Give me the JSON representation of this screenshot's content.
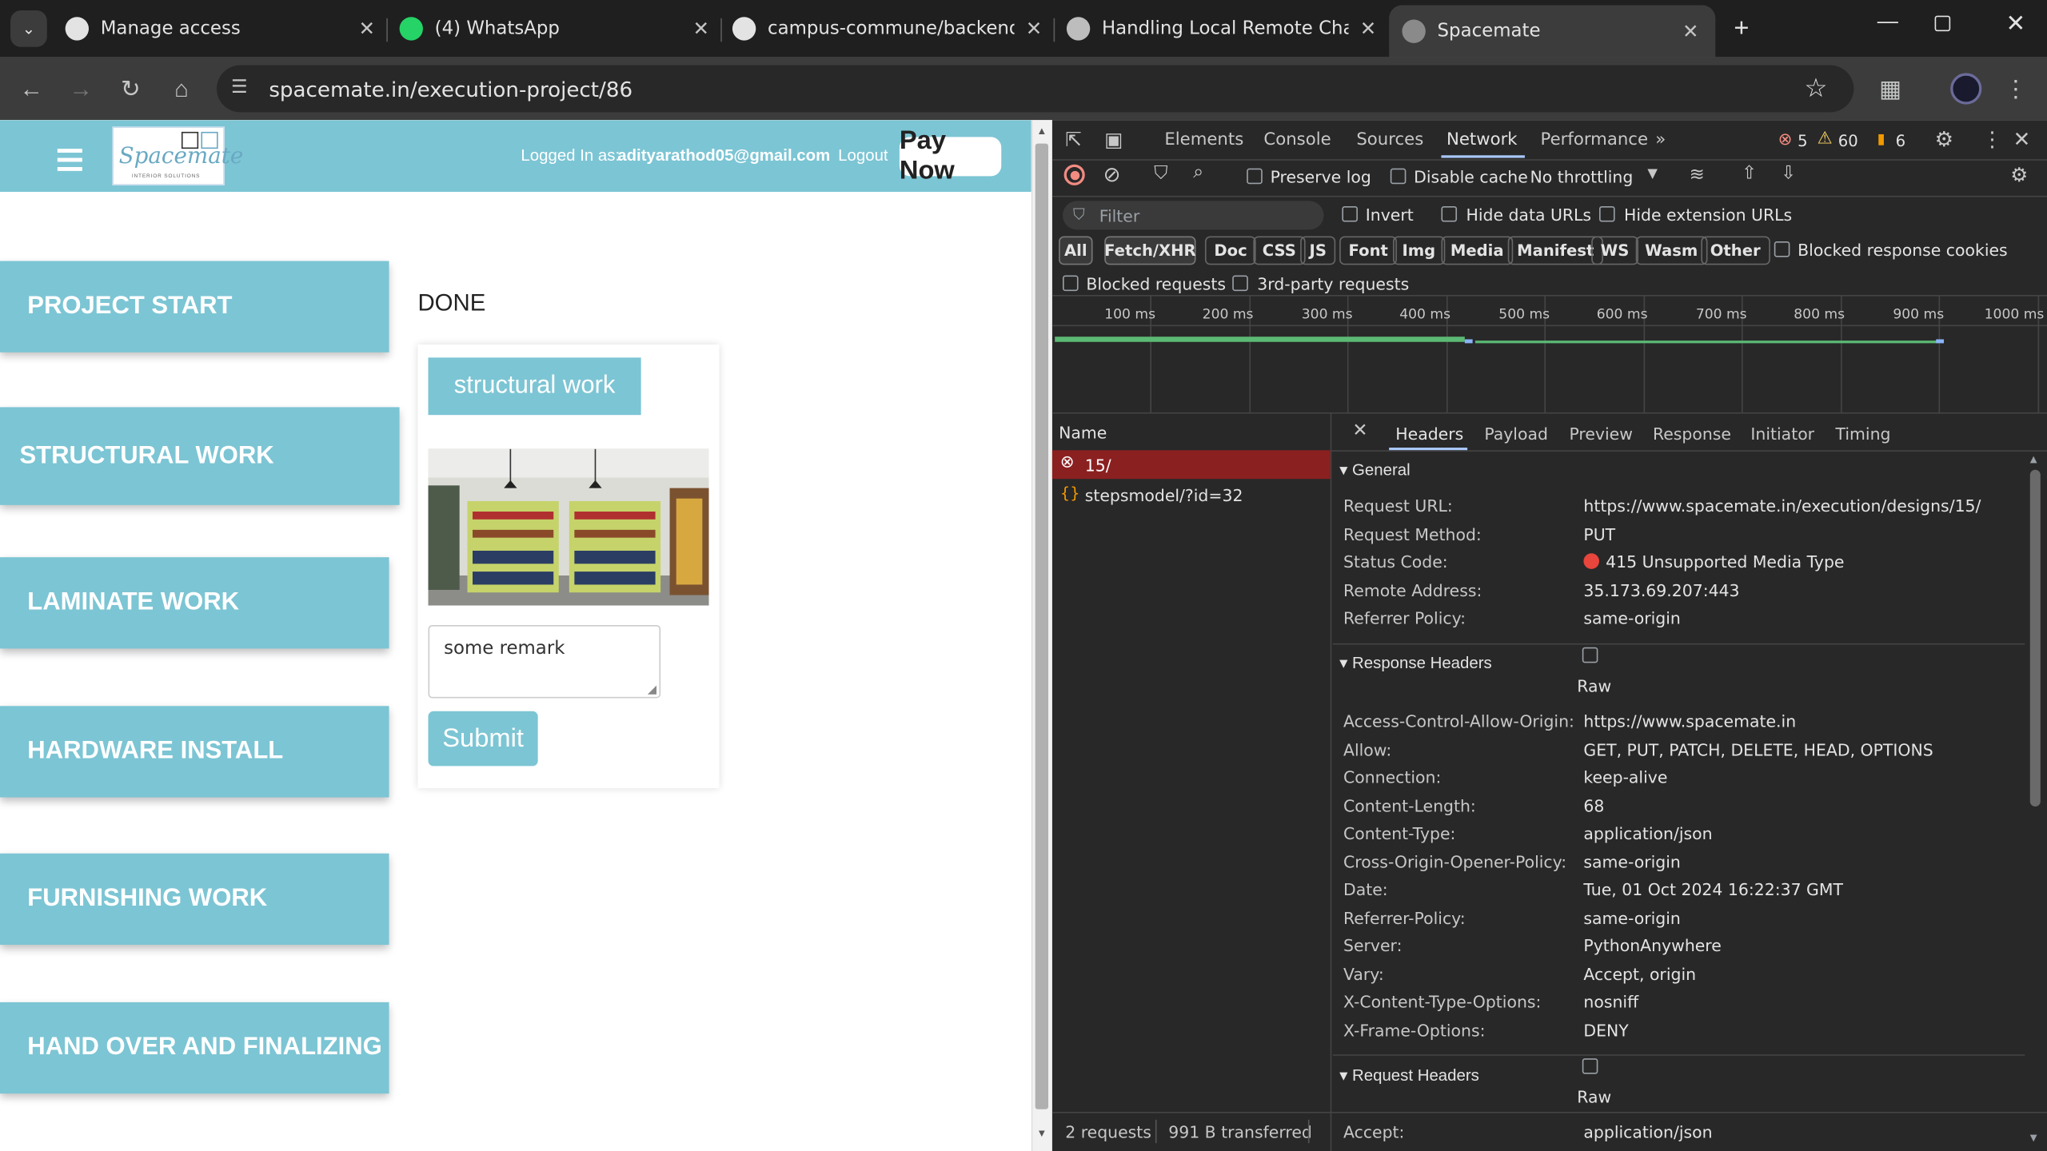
{
  "browser": {
    "tabs": [
      {
        "title": "Manage access"
      },
      {
        "title": "(4) WhatsApp"
      },
      {
        "title": "campus-commune/backend at"
      },
      {
        "title": "Handling Local Remote Change"
      },
      {
        "title": "Spacemate"
      }
    ],
    "url": "spacemate.in/execution-project/86"
  },
  "app": {
    "logo_text": "Spacemate",
    "logo_sub": "INTERIOR SOLUTIONS",
    "logged_in_label": "Logged In as:",
    "user_email": "adityarathod05@gmail.com",
    "logout": "Logout",
    "pay_now": "Pay Now",
    "stages": [
      "PROJECT START",
      "STRUCTURAL WORK",
      "LAMINATE WORK",
      "HARDWARE INSTALL",
      "FURNISHING WORK",
      "HAND OVER AND FINALIZING"
    ],
    "done_label": "DONE",
    "card_title": "structural work",
    "remark_value": "some remark",
    "submit": "Submit"
  },
  "devtools": {
    "tabs": [
      "Elements",
      "Console",
      "Sources",
      "Network",
      "Performance"
    ],
    "active_tab": "Network",
    "errors": "5",
    "warnings": "60",
    "issues": "6",
    "preserve_log": "Preserve log",
    "disable_cache": "Disable cache",
    "throttling": "No throttling",
    "filter_placeholder": "Filter",
    "invert": "Invert",
    "hide_data_urls": "Hide data URLs",
    "hide_ext_urls": "Hide extension URLs",
    "type_filters": [
      "All",
      "Fetch/XHR",
      "Doc",
      "CSS",
      "JS",
      "Font",
      "Img",
      "Media",
      "Manifest",
      "WS",
      "Wasm",
      "Other"
    ],
    "blocked_cookies": "Blocked response cookies",
    "blocked_requests": "Blocked requests",
    "third_party": "3rd-party requests",
    "timeline_ticks": [
      "100 ms",
      "200 ms",
      "300 ms",
      "400 ms",
      "500 ms",
      "600 ms",
      "700 ms",
      "800 ms",
      "900 ms",
      "1000 ms"
    ],
    "name_header": "Name",
    "requests": [
      "15/",
      "stepsmodel/?id=32"
    ],
    "detail_tabs": [
      "Headers",
      "Payload",
      "Preview",
      "Response",
      "Initiator",
      "Timing"
    ],
    "general_title": "General",
    "general": [
      {
        "k": "Request URL:",
        "v": "https://www.spacemate.in/execution/designs/15/"
      },
      {
        "k": "Request Method:",
        "v": "PUT"
      },
      {
        "k": "Status Code:",
        "v": "415 Unsupported Media Type"
      },
      {
        "k": "Remote Address:",
        "v": "35.173.69.207:443"
      },
      {
        "k": "Referrer Policy:",
        "v": "same-origin"
      }
    ],
    "response_headers_title": "Response Headers",
    "raw": "Raw",
    "response_headers": [
      {
        "k": "Access-Control-Allow-Origin:",
        "v": "https://www.spacemate.in"
      },
      {
        "k": "Allow:",
        "v": "GET, PUT, PATCH, DELETE, HEAD, OPTIONS"
      },
      {
        "k": "Connection:",
        "v": "keep-alive"
      },
      {
        "k": "Content-Length:",
        "v": "68"
      },
      {
        "k": "Content-Type:",
        "v": "application/json"
      },
      {
        "k": "Cross-Origin-Opener-Policy:",
        "v": "same-origin"
      },
      {
        "k": "Date:",
        "v": "Tue, 01 Oct 2024 16:22:37 GMT"
      },
      {
        "k": "Referrer-Policy:",
        "v": "same-origin"
      },
      {
        "k": "Server:",
        "v": "PythonAnywhere"
      },
      {
        "k": "Vary:",
        "v": "Accept, origin"
      },
      {
        "k": "X-Content-Type-Options:",
        "v": "nosniff"
      },
      {
        "k": "X-Frame-Options:",
        "v": "DENY"
      }
    ],
    "request_headers_title": "Request Headers",
    "request_headers": [
      {
        "k": "Accept:",
        "v": "application/json"
      }
    ],
    "status_requests": "2 requests",
    "status_transferred": "991 B transferred"
  }
}
